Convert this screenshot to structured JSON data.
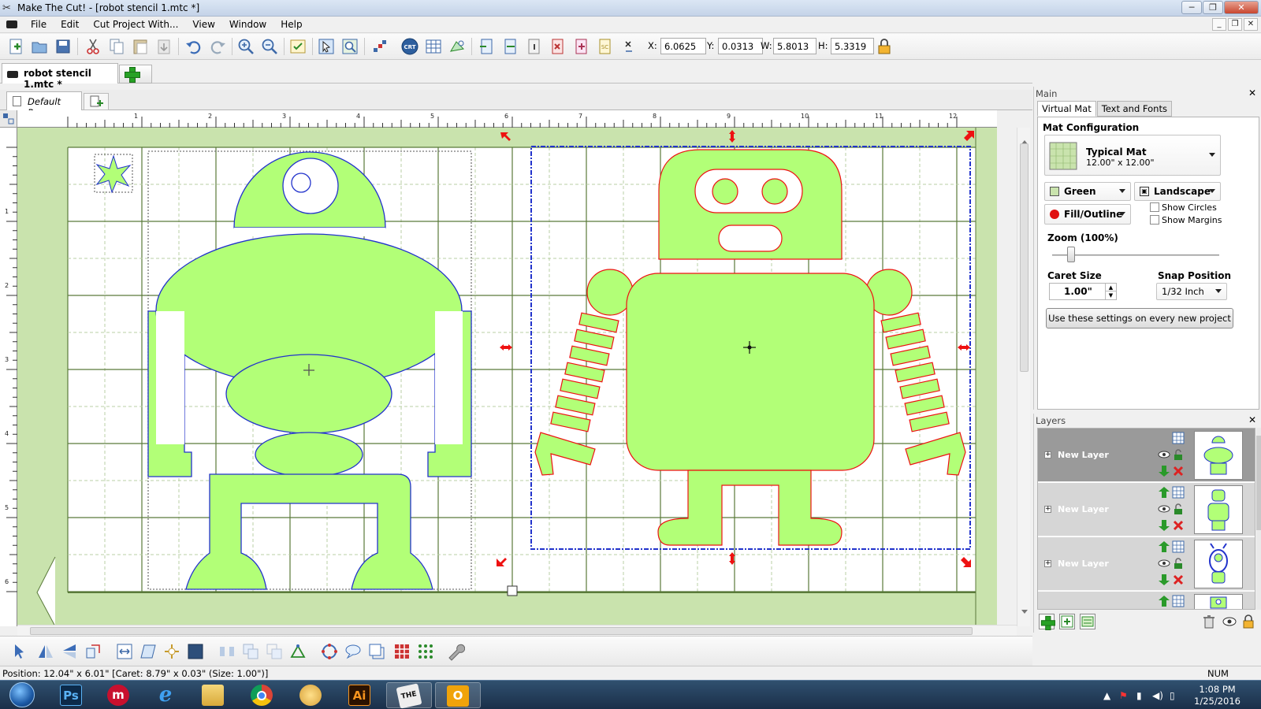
{
  "titlebar": {
    "title": "Make The Cut! - [robot stencil 1.mtc *]"
  },
  "menu": {
    "items": [
      "File",
      "Edit",
      "Cut Project With...",
      "View",
      "Window",
      "Help"
    ]
  },
  "toolbar": {
    "coords": [
      {
        "label": "X:",
        "value": "6.0625"
      },
      {
        "label": "Y:",
        "value": "0.0313"
      },
      {
        "label": "W:",
        "value": "5.8013"
      },
      {
        "label": "H:",
        "value": "5.3319"
      }
    ]
  },
  "document_tab": {
    "label": "robot stencil 1.mtc *"
  },
  "page_tab": {
    "label": "Default Page"
  },
  "ruler": {
    "top_labels": [
      "1",
      "2",
      "3",
      "4",
      "5",
      "6",
      "7",
      "8",
      "9",
      "10",
      "11",
      "12"
    ],
    "left_labels": [
      "1",
      "2",
      "3",
      "4",
      "5",
      "6"
    ]
  },
  "main_panel": {
    "title": "Main",
    "tabs": [
      "Virtual Mat",
      "Text and Fonts"
    ],
    "mat_configuration": {
      "title": "Mat Configuration",
      "mat_name": "Typical Mat",
      "mat_size": "12.00\" x 12.00\""
    },
    "color_select": "Green",
    "orientation_select": "Landscape",
    "display_select": "Fill/Outline",
    "show_circles": "Show Circles",
    "show_margins": "Show Margins",
    "zoom": {
      "label": "Zoom (100%)",
      "value_percent": 100
    },
    "caret_size": {
      "label": "Caret Size",
      "value": "1.00\""
    },
    "snap_position": {
      "label": "Snap Position",
      "value": "1/32 Inch"
    },
    "use_settings_button": "Use these settings on every new project"
  },
  "layers_panel": {
    "title": "Layers",
    "layers": [
      {
        "name": "New Layer",
        "selected": true
      },
      {
        "name": "New Layer",
        "selected": false
      },
      {
        "name": "New Layer",
        "selected": false
      }
    ]
  },
  "statusbar": {
    "position": "Position: 12.04\" x 6.01\" [Caret: 8.79\" x 0.03\" (Size: 1.00\")]",
    "num": "NUM"
  },
  "taskbar": {
    "time": "1:08 PM",
    "date": "1/25/2016",
    "apps": [
      "Ps",
      "Ai"
    ]
  },
  "colors": {
    "shape_fill": "#b2ff77",
    "robot1_stroke": "#2233cc",
    "robot2_stroke": "#ee1111",
    "mat": "#c9e3ad",
    "grid": "#5a7a3a"
  }
}
